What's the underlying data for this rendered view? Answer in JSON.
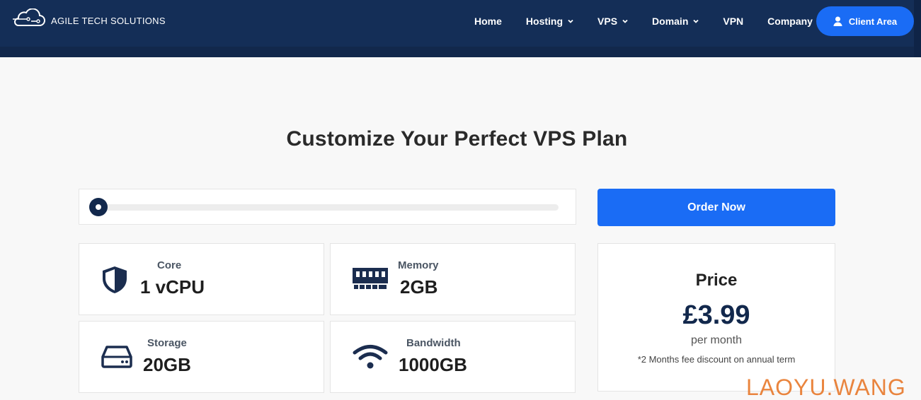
{
  "brand": {
    "name": "AGILE TECH SOLUTIONS",
    "logo_icon": "cloud-circuit-icon"
  },
  "nav": {
    "items": [
      {
        "label": "Home",
        "dropdown": false
      },
      {
        "label": "Hosting",
        "dropdown": true
      },
      {
        "label": "VPS",
        "dropdown": true
      },
      {
        "label": "Domain",
        "dropdown": true
      },
      {
        "label": "VPN",
        "dropdown": false
      },
      {
        "label": "Company",
        "dropdown": true
      }
    ],
    "client_area_label": "Client Area"
  },
  "main": {
    "title": "Customize Your Perfect VPS Plan",
    "slider": {
      "level": 0
    },
    "specs": [
      {
        "label": "Core",
        "value": "1 vCPU",
        "icon": "shield-icon"
      },
      {
        "label": "Memory",
        "value": "2GB",
        "icon": "memory-icon"
      },
      {
        "label": "Storage",
        "value": "20GB",
        "icon": "hard-drive-icon"
      },
      {
        "label": "Bandwidth",
        "value": "1000GB",
        "icon": "wifi-icon"
      }
    ],
    "order_button": "Order Now",
    "price": {
      "label": "Price",
      "amount": "£3.99",
      "period": "per month",
      "note": "*2 Months fee discount on annual term"
    }
  },
  "watermark": "LAOYU.WANG",
  "colors": {
    "navy": "#12284c",
    "accent": "#1a6cf5",
    "background": "#f8f8f8"
  }
}
